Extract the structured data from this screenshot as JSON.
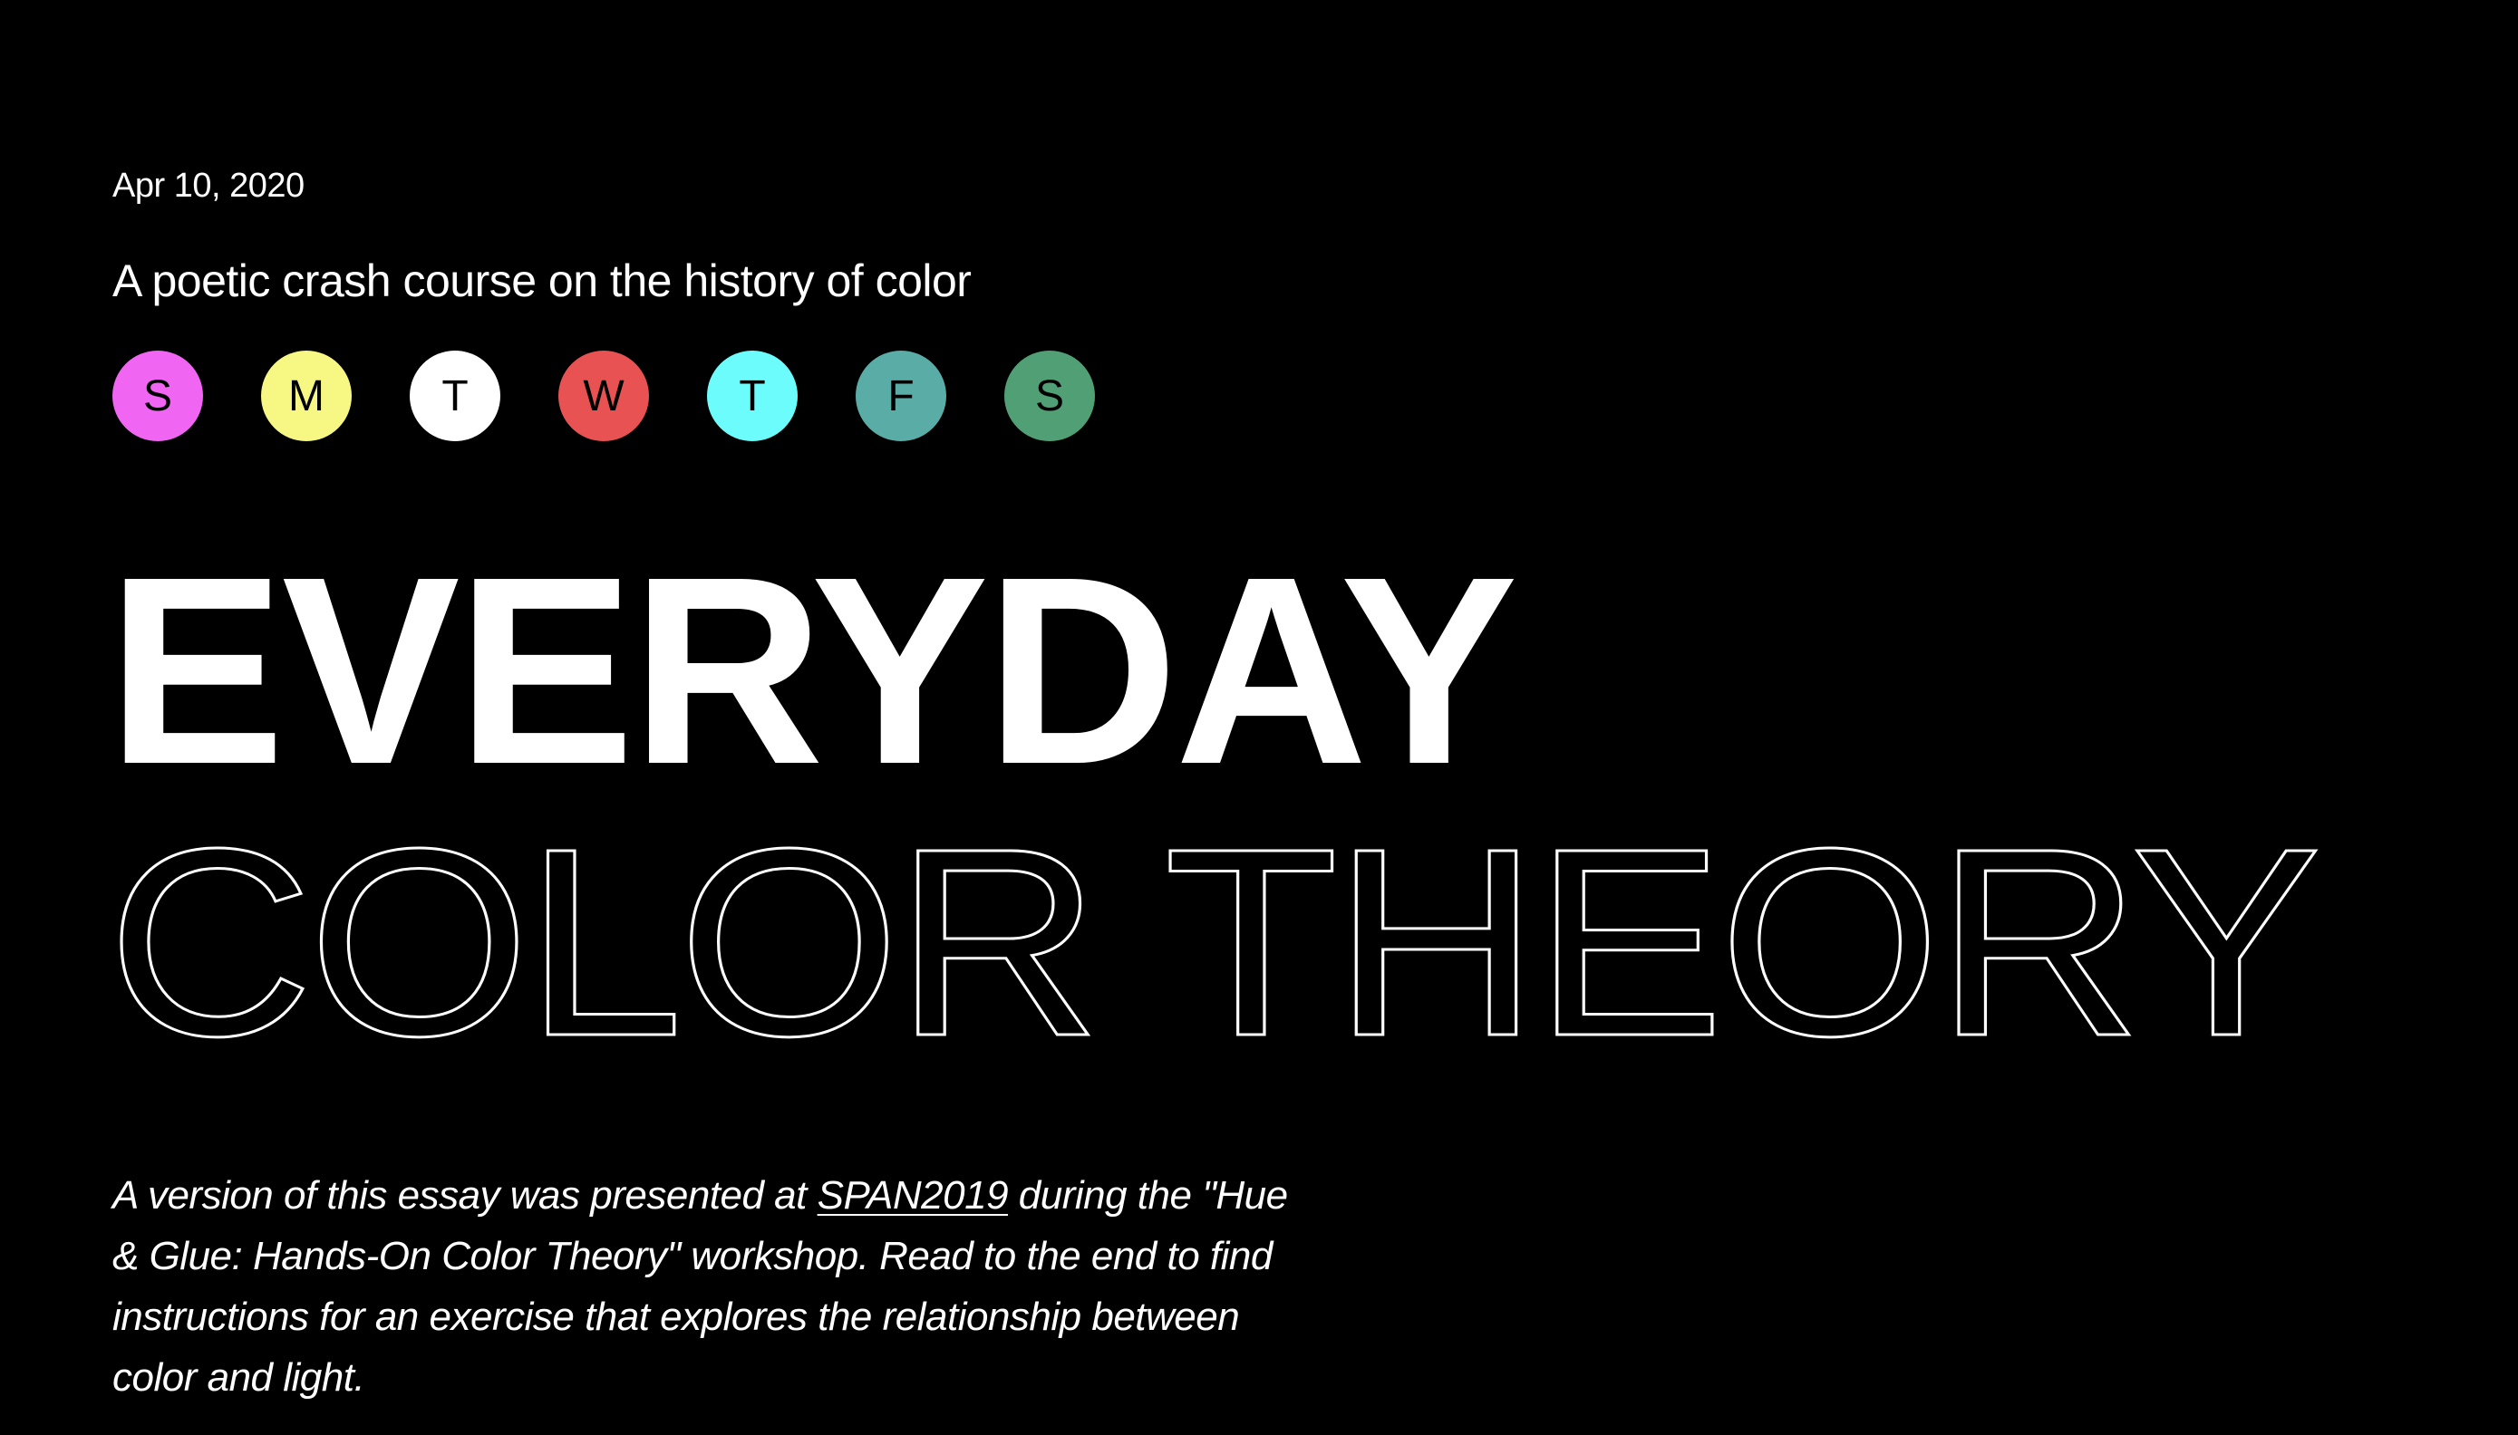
{
  "article": {
    "date": "Apr 10, 2020",
    "subtitle": "A poetic crash course on the history of color",
    "days": [
      {
        "letter": "S",
        "color": "#f065f2"
      },
      {
        "letter": "M",
        "color": "#f7f783"
      },
      {
        "letter": "T",
        "color": "#ffffff"
      },
      {
        "letter": "W",
        "color": "#e85252"
      },
      {
        "letter": "T",
        "color": "#6bfcfb"
      },
      {
        "letter": "F",
        "color": "#5aaca6"
      },
      {
        "letter": "S",
        "color": "#51a075"
      }
    ],
    "headline_line1": "EVERYDAY",
    "headline_line2": "COLOR THEORY",
    "intro": {
      "part1": "A version of this essay was presented at ",
      "link": "SPAN2019",
      "part2": " during the \"Hue & Glue: Hands-On Color Theory\" workshop. Read to the end to find instructions for an exercise that explores the relationship between color and light."
    }
  },
  "colors": {
    "background": "#000000",
    "text": "#ffffff"
  }
}
